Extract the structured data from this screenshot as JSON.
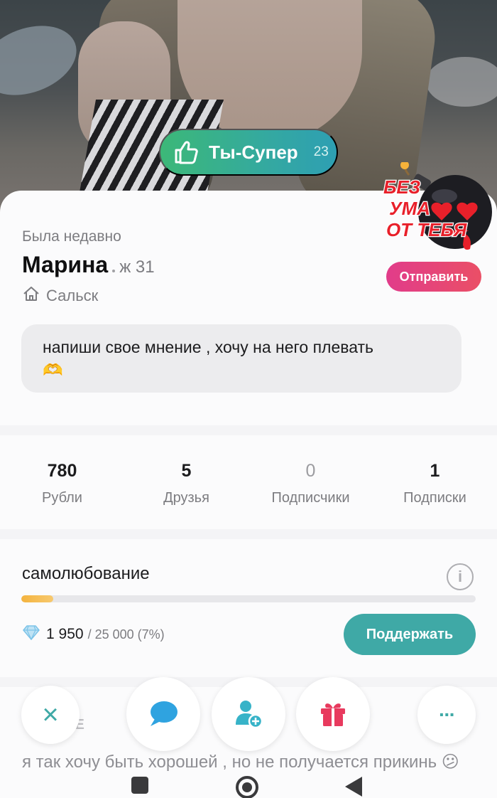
{
  "like": {
    "label": "Ты-Супер",
    "count": "23"
  },
  "sticker": {
    "line1": "БЕЗ",
    "line2": "УМА",
    "line3": "ОТ ТЕБЯ",
    "send_label": "Отправить"
  },
  "profile": {
    "status": "Была недавно",
    "name": "Марина",
    "age_sex": "ж 31",
    "city": "Сальск",
    "bio": "напиши свое мнение , хочу на него плевать",
    "bio_emoji": "🫶"
  },
  "stats": [
    {
      "value": "780",
      "label": "Рубли"
    },
    {
      "value": "5",
      "label": "Друзья"
    },
    {
      "value": "0",
      "label": "Подписчики"
    },
    {
      "value": "1",
      "label": "Подписки"
    }
  ],
  "goal": {
    "title": "самолюбование",
    "current": "1 950",
    "total": "/ 25 000 (7%)",
    "progress": 0.07,
    "support_label": "Поддержать",
    "info_icon": "i"
  },
  "next_section": {
    "header_fragment": "IE",
    "text": "я так хочу быть хорошей , но не получается прикинь 😕"
  },
  "actions": {
    "close_icon": "×",
    "more_icon": "···"
  },
  "colors": {
    "like_gradient_start": "#3cb878",
    "like_gradient_end": "#2e9fb3",
    "send_button": "#e13c8a",
    "support_button": "#3fa9a6",
    "progress_fill": "#f4b33e",
    "close_icon": "#3fa9a6",
    "chat_icon": "#2fa3e0",
    "add_friend_icon": "#37b3c8",
    "gift_icon": "#e83a5e"
  }
}
